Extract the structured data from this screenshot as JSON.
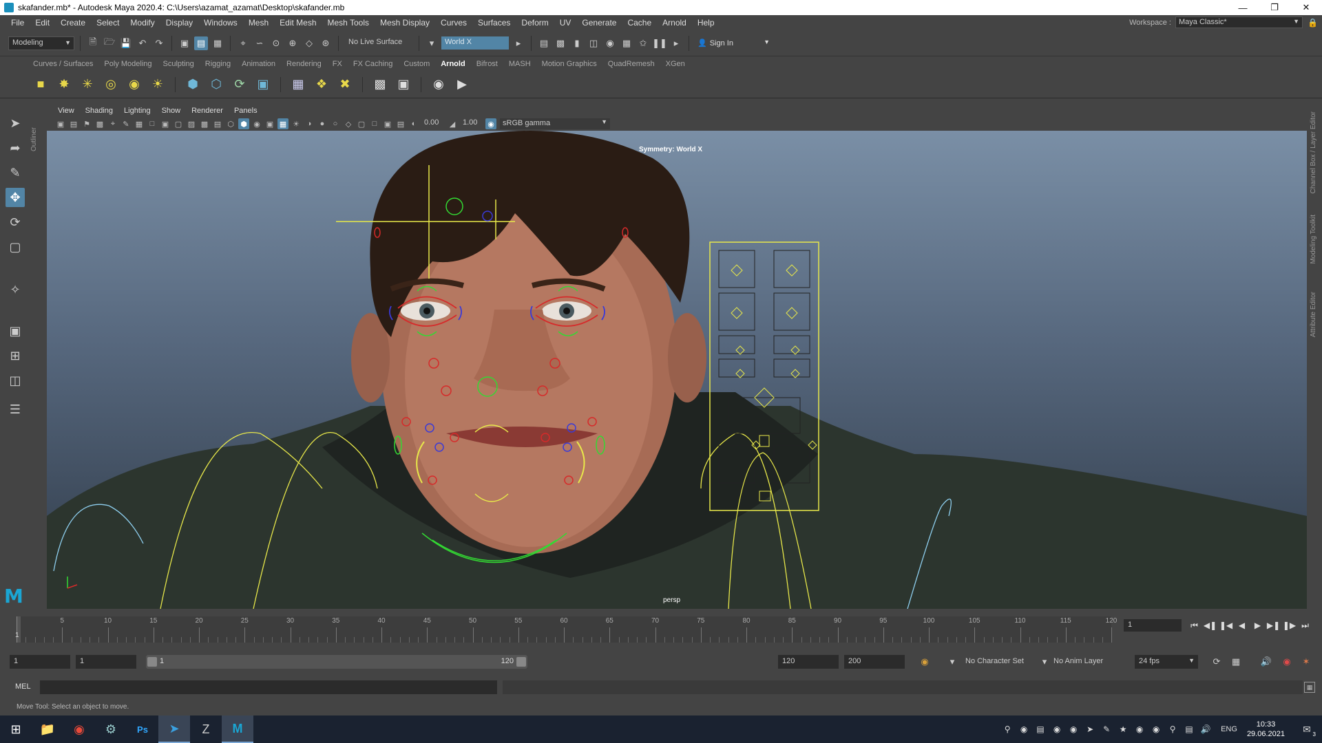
{
  "window": {
    "title": "skafander.mb* - Autodesk Maya 2020.4: C:\\Users\\azamat_azamat\\Desktop\\skafander.mb",
    "icon": "maya-app-icon"
  },
  "menubar": {
    "items": [
      "File",
      "Edit",
      "Create",
      "Select",
      "Modify",
      "Display",
      "Windows",
      "Mesh",
      "Edit Mesh",
      "Mesh Tools",
      "Mesh Display",
      "Curves",
      "Surfaces",
      "Deform",
      "UV",
      "Generate",
      "Cache",
      "Arnold",
      "Help"
    ],
    "workspace_label": "Workspace :",
    "workspace_value": "Maya Classic*"
  },
  "statusline": {
    "mode": "Modeling",
    "live_surface": "No Live Surface",
    "symmetry": "World X",
    "sign_in": "Sign In"
  },
  "shelf": {
    "tabs": [
      "Curves / Surfaces",
      "Poly Modeling",
      "Sculpting",
      "Rigging",
      "Animation",
      "Rendering",
      "FX",
      "FX Caching",
      "Custom",
      "Arnold",
      "Bifrost",
      "MASH",
      "Motion Graphics",
      "QuadRemesh",
      "XGen"
    ],
    "active_tab": "Arnold"
  },
  "outliner_tab": "Outliner",
  "panel": {
    "menus": [
      "View",
      "Shading",
      "Lighting",
      "Show",
      "Renderer",
      "Panels"
    ],
    "exposure": "0.00",
    "gamma": "1.00",
    "color_space": "sRGB gamma"
  },
  "viewport": {
    "hud_symmetry": "Symmetry: World X",
    "camera": "persp",
    "colors": {
      "ctrl_yellow": "#e8e84a",
      "ctrl_red": "#d62a2a",
      "ctrl_blue": "#3a3ad8",
      "ctrl_green": "#33d933",
      "ctrl_cyan": "#8fd0f0"
    }
  },
  "side_tabs": [
    "Channel Box / Layer Editor",
    "Modeling Toolkit",
    "Attribute Editor"
  ],
  "timeslider": {
    "tick_labels": [
      "5",
      "10",
      "15",
      "20",
      "25",
      "30",
      "35",
      "40",
      "45",
      "50",
      "55",
      "60",
      "65",
      "70",
      "75",
      "80",
      "85",
      "90",
      "95",
      "100",
      "105",
      "110",
      "115",
      "120"
    ],
    "current_frame_label": "1",
    "current_frame": "1"
  },
  "range": {
    "start": "1",
    "anim_start": "1",
    "slider_start": "1",
    "slider_end": "120",
    "end": "120",
    "anim_end": "200",
    "character_set": "No Character Set",
    "anim_layer": "No Anim Layer",
    "fps": "24 fps"
  },
  "cmdline": {
    "label": "MEL",
    "help": "Move Tool: Select an object to move."
  },
  "taskbar": {
    "language": "ENG",
    "time": "10:33",
    "date": "29.06.2021",
    "notifications": "3"
  }
}
